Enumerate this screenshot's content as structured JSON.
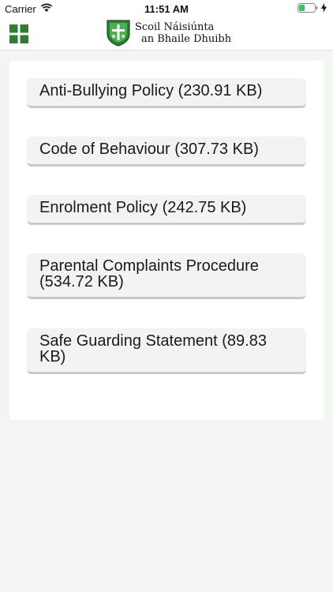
{
  "status_bar": {
    "carrier": "Carrier",
    "time": "11:51 AM"
  },
  "header": {
    "school_name_line1": "Scoil Náisiúnta",
    "school_name_line2": "an Bhaile Dhuibh",
    "menu_icon": "grid-icon",
    "accent_color": "#2e7d32"
  },
  "documents": [
    {
      "label": "Anti-Bullying Policy (230.91 KB)"
    },
    {
      "label": "Code of Behaviour (307.73 KB)"
    },
    {
      "label": "Enrolment Policy (242.75 KB)"
    },
    {
      "label": "Parental Complaints Procedure (534.72 KB)"
    },
    {
      "label": "Safe Guarding Statement (89.83 KB)"
    }
  ]
}
